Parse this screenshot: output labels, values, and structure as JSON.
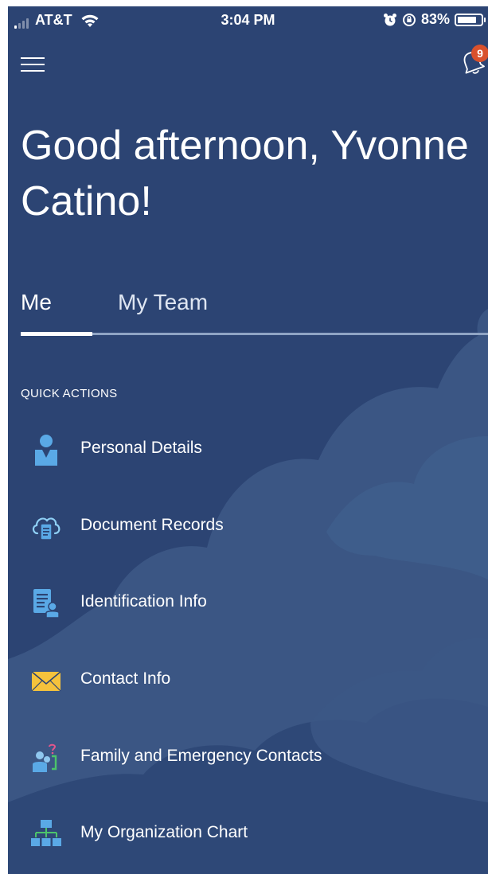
{
  "status_bar": {
    "carrier": "AT&T",
    "time": "3:04 PM",
    "battery_percent": "83%",
    "battery_level": 0.83,
    "icons": [
      "signal-icon",
      "wifi-icon",
      "alarm-icon",
      "rotation-lock-icon",
      "battery-icon"
    ]
  },
  "header": {
    "menu_icon": "hamburger-menu-icon",
    "notifications_icon": "bell-icon",
    "notification_count": "9"
  },
  "greeting": {
    "text": "Good afternoon, Yvonne Catino!"
  },
  "tabs": [
    {
      "label": "Me",
      "selected": true
    },
    {
      "label": "My Team",
      "selected": false
    }
  ],
  "quick_actions": {
    "heading": "QUICK ACTIONS",
    "items": [
      {
        "label": "Personal Details",
        "icon": "person-icon"
      },
      {
        "label": "Document Records",
        "icon": "cloud-document-icon"
      },
      {
        "label": "Identification Info",
        "icon": "id-document-icon"
      },
      {
        "label": "Contact Info",
        "icon": "envelope-icon"
      },
      {
        "label": "Family and Emergency Contacts",
        "icon": "family-contacts-icon"
      },
      {
        "label": "My Organization Chart",
        "icon": "org-chart-icon"
      }
    ]
  },
  "colors": {
    "background": "#2c4473",
    "cloud": "#3e5a86",
    "badge": "#d9512c",
    "icon_blue": "#5aa9e6",
    "icon_yellow": "#f5c23c",
    "tab_track": "#8fa4c4"
  }
}
